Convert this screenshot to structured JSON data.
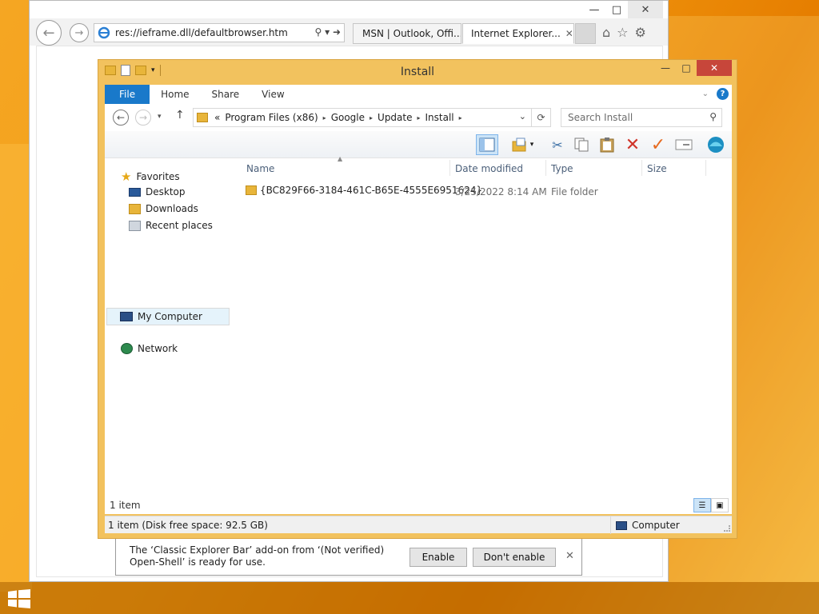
{
  "ie": {
    "address": "res://ieframe.dll/defaultbrowser.htm",
    "tabs": [
      {
        "label": "MSN | Outlook, Offi..."
      },
      {
        "label": "Internet Explorer..."
      }
    ],
    "tab_close": "✕"
  },
  "explorer": {
    "title": "Install",
    "ribbon_tabs": [
      "File",
      "Home",
      "Share",
      "View"
    ],
    "breadcrumb": {
      "prefix": "«",
      "segments": [
        "Program Files (x86)",
        "Google",
        "Update",
        "Install"
      ]
    },
    "search_placeholder": "Search Install",
    "nav_pane": {
      "favorites": "Favorites",
      "desktop": "Desktop",
      "downloads": "Downloads",
      "recent": "Recent places",
      "computer": "My Computer",
      "network": "Network"
    },
    "columns": [
      "Name",
      "Date modified",
      "Type",
      "Size"
    ],
    "files": [
      {
        "name": "{BC829F66-3184-461C-B65E-4555E6951624}",
        "date": "3/25/2022 8:14 AM",
        "type": "File folder",
        "size": ""
      }
    ],
    "item_count": "1 item",
    "status_left": "1 item (Disk free space: 92.5 GB)",
    "status_right": "Computer"
  },
  "notification": {
    "line1": "The ‘Classic Explorer Bar’ add-on from ‘(Not verified)",
    "line2": "Open-Shell’ is ready for use.",
    "enable": "Enable",
    "dont_enable": "Don't enable",
    "close": "✕"
  },
  "colors": {
    "file_tab": "#1979ca",
    "window_frame": "#f2c25e",
    "close_button": "#c7463a",
    "desktop": "#f39c12"
  }
}
